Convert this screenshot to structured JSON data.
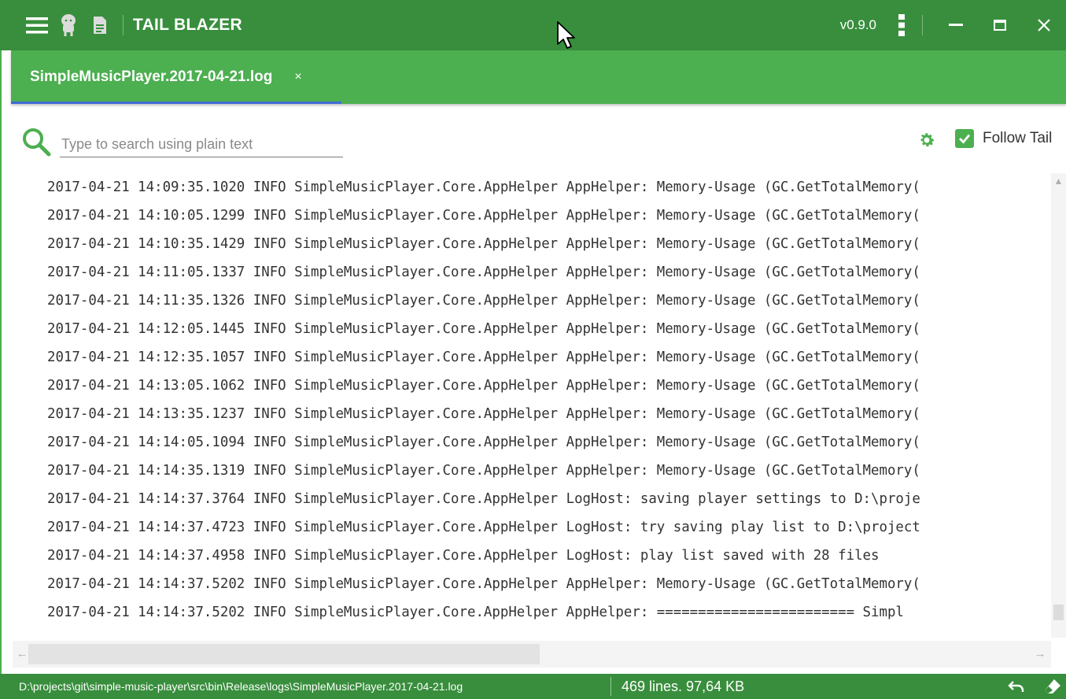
{
  "titlebar": {
    "title": "TAIL BLAZER",
    "version": "v0.9.0",
    "icons": [
      "menu-icon",
      "github-icon",
      "document-icon",
      "kebab-menu-icon",
      "minimize-icon",
      "maximize-icon",
      "close-icon"
    ]
  },
  "tabs": [
    {
      "label": "SimpleMusicPlayer.2017-04-21.log",
      "close_glyph": "×",
      "active": true
    }
  ],
  "search": {
    "placeholder": "Type to search using plain text",
    "value": ""
  },
  "toolbar": {
    "follow_tail_label": "Follow Tail",
    "follow_tail_checked": true
  },
  "log_lines": [
    "2017-04-21 14:09:35.1020 INFO SimpleMusicPlayer.Core.AppHelper AppHelper: Memory-Usage (GC.GetTotalMemory(",
    "2017-04-21 14:10:05.1299 INFO SimpleMusicPlayer.Core.AppHelper AppHelper: Memory-Usage (GC.GetTotalMemory(",
    "2017-04-21 14:10:35.1429 INFO SimpleMusicPlayer.Core.AppHelper AppHelper: Memory-Usage (GC.GetTotalMemory(",
    "2017-04-21 14:11:05.1337 INFO SimpleMusicPlayer.Core.AppHelper AppHelper: Memory-Usage (GC.GetTotalMemory(",
    "2017-04-21 14:11:35.1326 INFO SimpleMusicPlayer.Core.AppHelper AppHelper: Memory-Usage (GC.GetTotalMemory(",
    "2017-04-21 14:12:05.1445 INFO SimpleMusicPlayer.Core.AppHelper AppHelper: Memory-Usage (GC.GetTotalMemory(",
    "2017-04-21 14:12:35.1057 INFO SimpleMusicPlayer.Core.AppHelper AppHelper: Memory-Usage (GC.GetTotalMemory(",
    "2017-04-21 14:13:05.1062 INFO SimpleMusicPlayer.Core.AppHelper AppHelper: Memory-Usage (GC.GetTotalMemory(",
    "2017-04-21 14:13:35.1237 INFO SimpleMusicPlayer.Core.AppHelper AppHelper: Memory-Usage (GC.GetTotalMemory(",
    "2017-04-21 14:14:05.1094 INFO SimpleMusicPlayer.Core.AppHelper AppHelper: Memory-Usage (GC.GetTotalMemory(",
    "2017-04-21 14:14:35.1319 INFO SimpleMusicPlayer.Core.AppHelper AppHelper: Memory-Usage (GC.GetTotalMemory(",
    "2017-04-21 14:14:37.3764 INFO SimpleMusicPlayer.Core.AppHelper LogHost: saving player settings to D:\\proje",
    "2017-04-21 14:14:37.4723 INFO SimpleMusicPlayer.Core.AppHelper LogHost: try saving play list to D:\\project",
    "2017-04-21 14:14:37.4958 INFO SimpleMusicPlayer.Core.AppHelper LogHost: play list saved with 28 files",
    "2017-04-21 14:14:37.5202 INFO SimpleMusicPlayer.Core.AppHelper AppHelper: Memory-Usage (GC.GetTotalMemory(",
    "2017-04-21 14:14:37.5202 INFO SimpleMusicPlayer.Core.AppHelper AppHelper: ======================== Simpl"
  ],
  "status": {
    "path": "D:\\projects\\git\\simple-music-player\\src\\bin\\Release\\logs\\SimpleMusicPlayer.2017-04-21.log",
    "info": "469 lines.  97,64 KB"
  },
  "colors": {
    "titlebar": "#388e3c",
    "tabbar": "#4caf50",
    "accent": "#4caf50",
    "tab_indicator": "#3f6bd6"
  }
}
